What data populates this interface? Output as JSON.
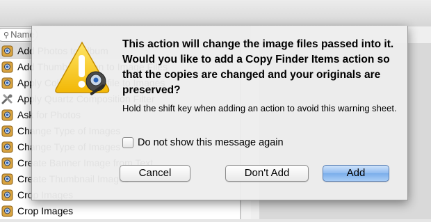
{
  "search": {
    "placeholder": "Name"
  },
  "list": {
    "items": [
      {
        "label": "Add Photos to Album",
        "icon": "automator-icon"
      },
      {
        "label": "Add Thumbnail Icon to Image Files",
        "icon": "automator-icon"
      },
      {
        "label": "Apply ColorSync Profile to Images",
        "icon": "automator-icon"
      },
      {
        "label": "Apply Quartz Composition Filter",
        "icon": "tools-icon"
      },
      {
        "label": "Ask for Photos",
        "icon": "automator-icon"
      },
      {
        "label": "Change Type of Images",
        "icon": "automator-icon"
      },
      {
        "label": "Change Type of Images",
        "icon": "automator-icon"
      },
      {
        "label": "Create Banner Image from Text",
        "icon": "automator-icon"
      },
      {
        "label": "Create Thumbnail Images",
        "icon": "automator-icon"
      },
      {
        "label": "Crop Images",
        "icon": "automator-icon"
      },
      {
        "label": "Crop Images",
        "icon": "automator-icon"
      }
    ]
  },
  "dialog": {
    "headline": "This action will change the image files passed into it.  Would you like to add a Copy Finder Items action so that the copies are changed and your originals are preserved?",
    "hint": "Hold the shift key when adding an action to avoid this warning sheet.",
    "checkbox_label": "Do not show this message again",
    "checkbox_checked": false,
    "cancel_label": "Cancel",
    "dont_add_label": "Don't Add",
    "add_label": "Add",
    "accent_color": "#7aaeea"
  }
}
